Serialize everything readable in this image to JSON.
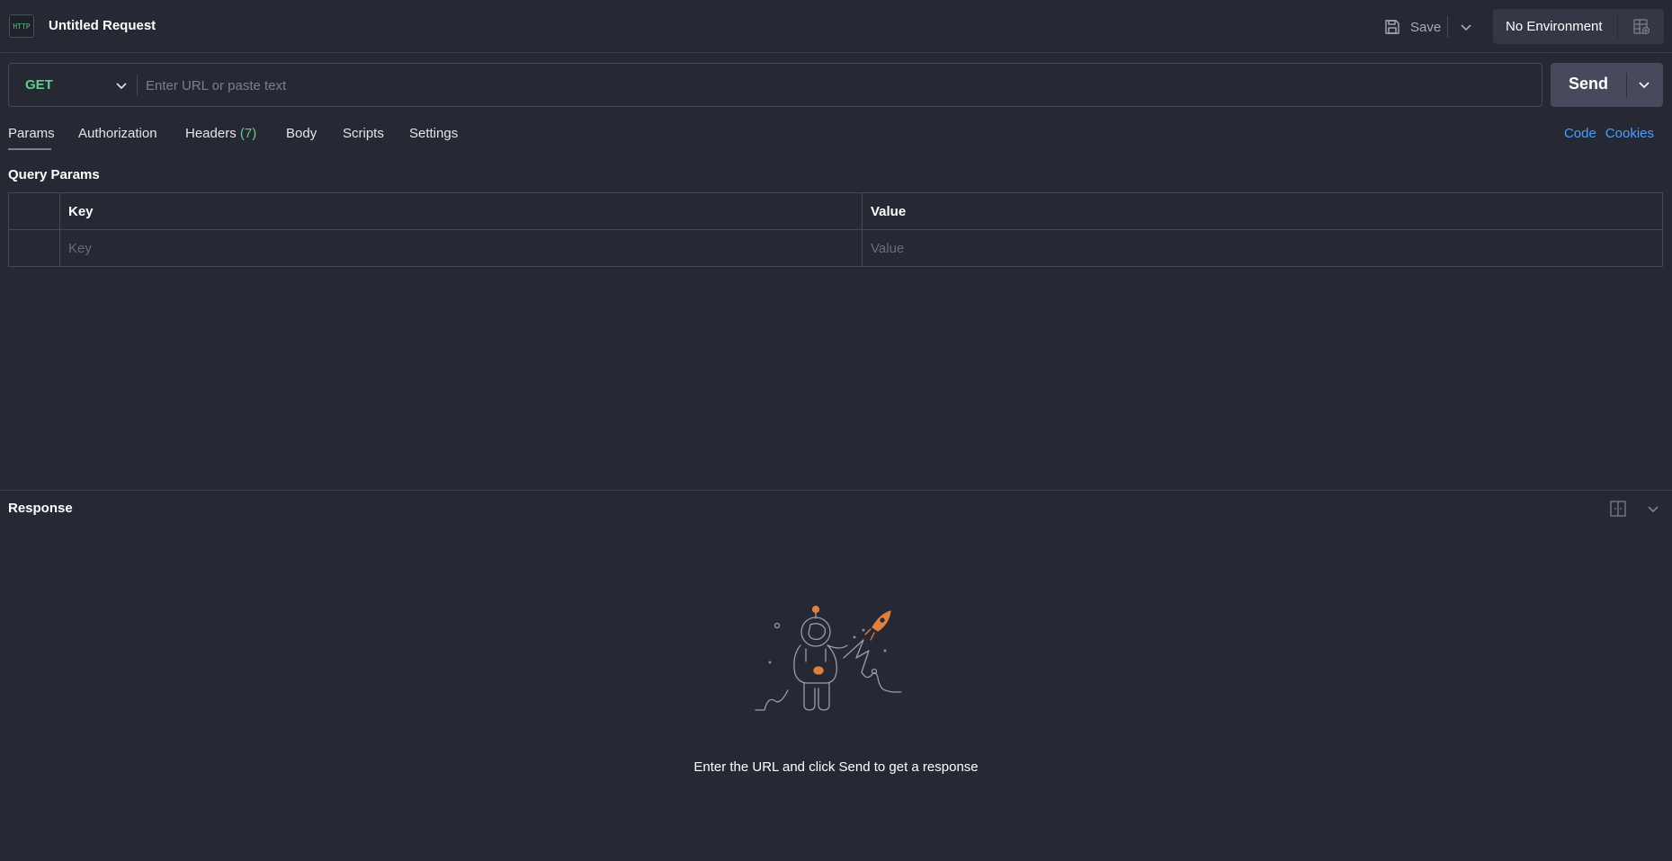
{
  "header": {
    "icon_label": "HTTP",
    "title": "Untitled Request",
    "save_label": "Save",
    "environment_label": "No Environment"
  },
  "request": {
    "method": "GET",
    "url_value": "",
    "url_placeholder": "Enter URL or paste text",
    "send_label": "Send"
  },
  "tabs": {
    "items": [
      {
        "label": "Params"
      },
      {
        "label": "Authorization"
      },
      {
        "label": "Headers",
        "count": "(7)"
      },
      {
        "label": "Body"
      },
      {
        "label": "Scripts"
      },
      {
        "label": "Settings"
      }
    ],
    "active": "Params",
    "side_links": [
      "Code",
      "Cookies"
    ]
  },
  "query_params": {
    "title": "Query Params",
    "columns": [
      "Key",
      "Value"
    ],
    "key_placeholder": "Key",
    "value_placeholder": "Value"
  },
  "response": {
    "title": "Response",
    "empty_message": "Enter the URL and click Send to get a response"
  },
  "colors": {
    "background": "#262833",
    "method_get": "#5fd08a",
    "link": "#4a9eff",
    "send_button": "#464a5c",
    "rocket": "#e0803a"
  }
}
